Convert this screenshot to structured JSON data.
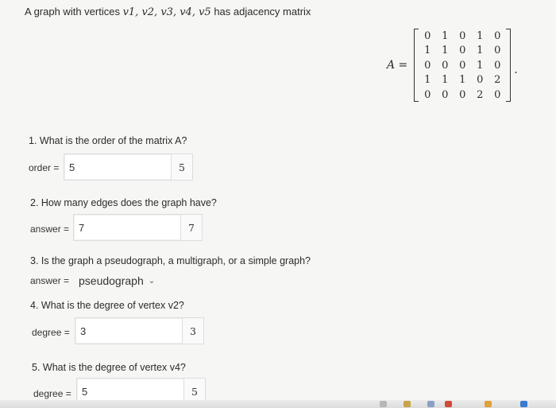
{
  "intro": {
    "prefix": "A graph with vertices ",
    "vertices": "v1, v2, v3, v4, v5",
    "suffix": " has adjacency matrix"
  },
  "matrix": {
    "label": "A =",
    "rows": [
      [
        "0",
        "1",
        "0",
        "1",
        "0"
      ],
      [
        "1",
        "1",
        "0",
        "1",
        "0"
      ],
      [
        "0",
        "0",
        "0",
        "1",
        "0"
      ],
      [
        "1",
        "1",
        "1",
        "0",
        "2"
      ],
      [
        "0",
        "0",
        "0",
        "2",
        "0"
      ]
    ],
    "end": "."
  },
  "questions": [
    {
      "text": "1. What is the order of the matrix A?",
      "field_label": "order =",
      "value": "5",
      "preview": "5"
    },
    {
      "text": "2. How many edges does the graph have?",
      "field_label": "answer =",
      "value": "7",
      "preview": "7"
    },
    {
      "text": "3. Is the graph a pseudograph, a multigraph, or a simple graph?",
      "field_label": "answer =",
      "selected": "pseudograph"
    },
    {
      "text": "4. What is the degree of vertex v2?",
      "field_label": "degree =",
      "value": "3",
      "preview": "3"
    },
    {
      "text": "5. What is the degree of vertex v4?",
      "field_label": "degree =",
      "value": "5",
      "preview": "5"
    }
  ]
}
